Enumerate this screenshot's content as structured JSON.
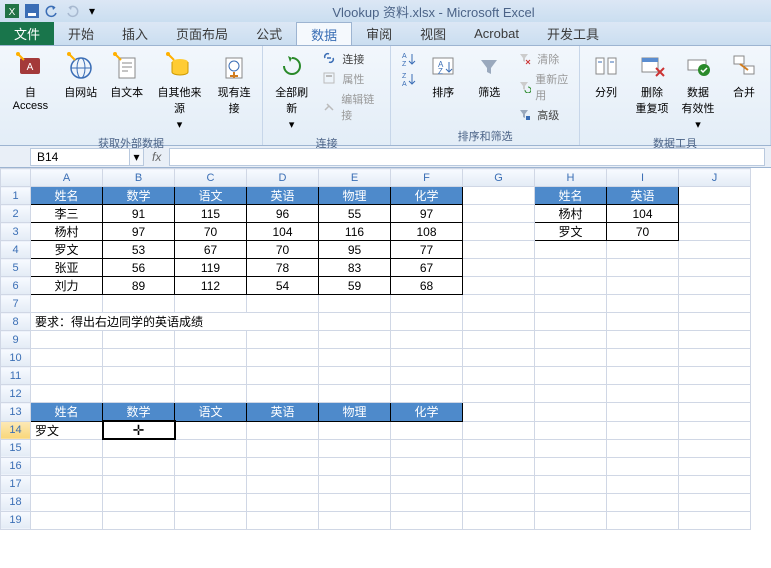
{
  "app_title": "Vlookup 资料.xlsx - Microsoft Excel",
  "tabs": {
    "file": "文件",
    "home": "开始",
    "insert": "插入",
    "layout": "页面布局",
    "formula": "公式",
    "data": "数据",
    "review": "审阅",
    "view": "视图",
    "acrobat": "Acrobat",
    "dev": "开发工具"
  },
  "ribbon": {
    "ext": {
      "access": "自 Access",
      "web": "自网站",
      "text": "自文本",
      "other": "自其他来源",
      "existing": "现有连接",
      "label": "获取外部数据"
    },
    "conn": {
      "refresh": "全部刷新",
      "conn": "连接",
      "prop": "属性",
      "editlink": "编辑链接",
      "label": "连接"
    },
    "sort": {
      "az": "A↓Z",
      "za": "Z↓A",
      "sort": "排序",
      "filter": "筛选",
      "clear": "清除",
      "reapply": "重新应用",
      "adv": "高级",
      "label": "排序和筛选"
    },
    "tools": {
      "col": "分列",
      "dedup": "删除\n重复项",
      "valid": "数据\n有效性",
      "merge": "合并",
      "label": "数据工具"
    }
  },
  "name_box": "B14",
  "chart_data": {
    "type": "table",
    "columns": [
      "姓名",
      "数学",
      "语文",
      "英语",
      "物理",
      "化学"
    ],
    "rows": [
      [
        "李三",
        91,
        115,
        96,
        55,
        97
      ],
      [
        "杨村",
        97,
        70,
        104,
        116,
        108
      ],
      [
        "罗文",
        53,
        67,
        70,
        95,
        77
      ],
      [
        "张亚",
        56,
        119,
        78,
        83,
        67
      ],
      [
        "刘力",
        89,
        112,
        54,
        59,
        68
      ]
    ],
    "lookup_table": {
      "columns": [
        "姓名",
        "英语"
      ],
      "rows": [
        [
          "杨村",
          104
        ],
        [
          "罗文",
          70
        ]
      ]
    },
    "note": "要求：得出右边同学的英语成绩",
    "second_header": [
      "姓名",
      "数学",
      "语文",
      "英语",
      "物理",
      "化学"
    ],
    "second_row_name": "罗文"
  },
  "col_letters": [
    "A",
    "B",
    "C",
    "D",
    "E",
    "F",
    "G",
    "H",
    "I",
    "J"
  ]
}
